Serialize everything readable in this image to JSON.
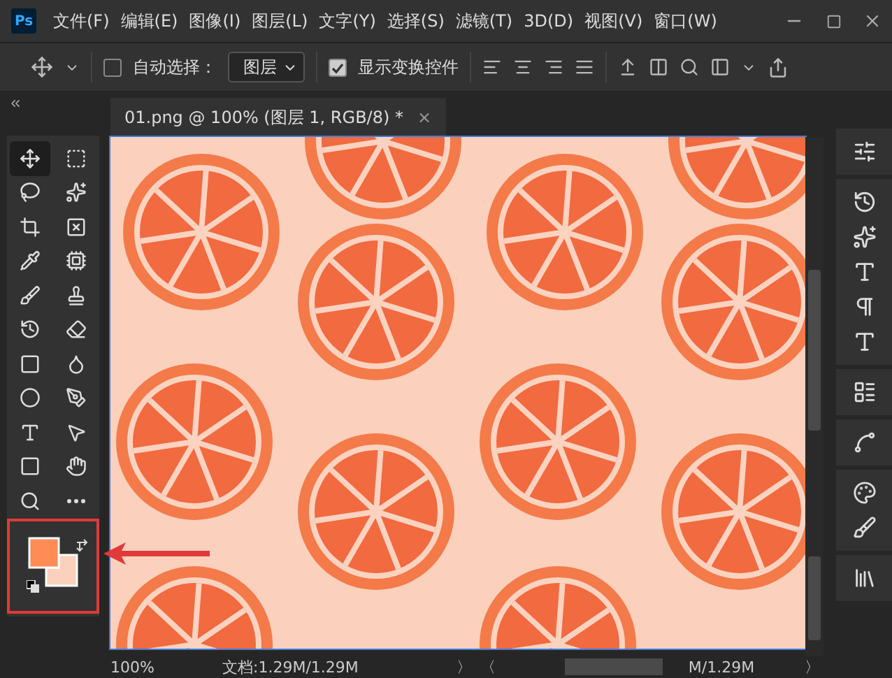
{
  "app": {
    "logo": "Ps"
  },
  "menu": [
    {
      "label": "文件(F)"
    },
    {
      "label": "编辑(E)"
    },
    {
      "label": "图像(I)"
    },
    {
      "label": "图层(L)"
    },
    {
      "label": "文字(Y)"
    },
    {
      "label": "选择(S)"
    },
    {
      "label": "滤镜(T)"
    },
    {
      "label": "3D(D)"
    },
    {
      "label": "视图(V)"
    },
    {
      "label": "窗口(W)"
    }
  ],
  "options_bar": {
    "auto_select": {
      "label": "自动选择：",
      "checked": false
    },
    "target": {
      "value": "图层"
    },
    "show_transform": {
      "label": "显示变换控件",
      "checked": true
    }
  },
  "document_tab": {
    "title": "01.png @ 100% (图层 1, RGB/8) *",
    "close": "×",
    "selected": true
  },
  "tools": [
    {
      "kind": "move",
      "selected": true
    },
    {
      "kind": "marquee",
      "selected": false
    },
    {
      "kind": "lasso",
      "selected": false
    },
    {
      "kind": "quick-select",
      "selected": false
    },
    {
      "kind": "crop",
      "selected": false
    },
    {
      "kind": "frame",
      "selected": false
    },
    {
      "kind": "eyedropper",
      "selected": false
    },
    {
      "kind": "patch",
      "selected": false
    },
    {
      "kind": "brush",
      "selected": false
    },
    {
      "kind": "stamp",
      "selected": false
    },
    {
      "kind": "history-brush",
      "selected": false
    },
    {
      "kind": "eraser",
      "selected": false
    },
    {
      "kind": "gradient",
      "selected": false
    },
    {
      "kind": "smudge",
      "selected": false
    },
    {
      "kind": "dodge",
      "selected": false
    },
    {
      "kind": "pen",
      "selected": false
    },
    {
      "kind": "type",
      "selected": false
    },
    {
      "kind": "pointer",
      "selected": false
    },
    {
      "kind": "shape",
      "selected": false
    },
    {
      "kind": "hand",
      "selected": false
    },
    {
      "kind": "zoom",
      "selected": false
    },
    {
      "kind": "more",
      "selected": false
    }
  ],
  "right_panel": [
    {
      "kind": "adjust"
    },
    {
      "kind": "history"
    },
    {
      "kind": "fx"
    },
    {
      "kind": "character"
    },
    {
      "kind": "paragraph"
    },
    {
      "kind": "glyphs"
    },
    {
      "kind": "properties"
    },
    {
      "kind": "paths"
    },
    {
      "kind": "palette"
    },
    {
      "kind": "brushes"
    },
    {
      "kind": "libraries"
    }
  ],
  "status_bar": {
    "zoom": "100%",
    "doc_info": "文档:1.29M/1.29M",
    "next": "〉",
    "prev": "〈",
    "doc_info_2": "M/1.29M",
    "next_2": "〉"
  }
}
